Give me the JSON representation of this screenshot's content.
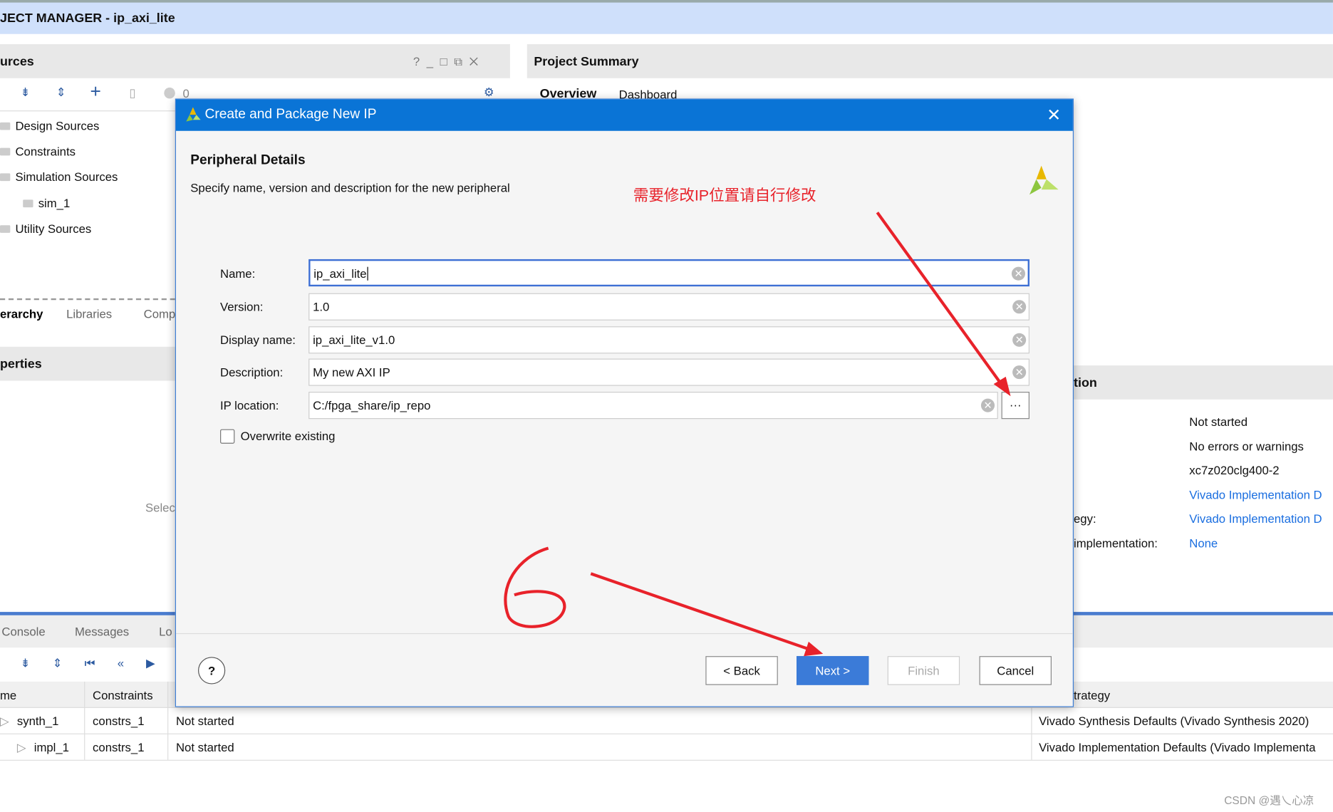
{
  "window": {
    "title": "JECT MANAGER - ip_axi_lite"
  },
  "sources": {
    "title": "urces",
    "count": "0",
    "items": [
      "Design Sources",
      "Constraints",
      "Simulation Sources",
      "sim_1",
      "Utility Sources"
    ],
    "tabs": [
      "erarchy",
      "Libraries",
      "Comp"
    ]
  },
  "properties": {
    "title": "perties",
    "hint": "Selec"
  },
  "summary": {
    "title": "Project Summary",
    "tabs": [
      "Overview",
      "Dashboard"
    ],
    "section": "tion",
    "rows": [
      {
        "label": "",
        "value": "Not started",
        "link": false
      },
      {
        "label": "",
        "value": "No errors or warnings",
        "link": false
      },
      {
        "label": "",
        "value": "xc7z020clg400-2",
        "link": false
      },
      {
        "label": "",
        "value": "Vivado Implementation D",
        "link": true
      },
      {
        "label": "egy:",
        "value": "Vivado Implementation D",
        "link": true
      },
      {
        "label": "implementation:",
        "value": "None",
        "link": true
      }
    ]
  },
  "console": {
    "tabs": [
      "Console",
      "Messages",
      "Lo"
    ]
  },
  "runs": {
    "headers": [
      "me",
      "Constraints",
      "trategy"
    ],
    "rows": [
      {
        "name": "synth_1",
        "constraints": "constrs_1",
        "status": "Not started",
        "strategy": "Vivado Synthesis Defaults (Vivado Synthesis 2020)"
      },
      {
        "name": "impl_1",
        "constraints": "constrs_1",
        "status": "Not started",
        "strategy": "Vivado Implementation Defaults (Vivado Implementa"
      }
    ]
  },
  "dialog": {
    "title": "Create and Package New IP",
    "heading": "Peripheral Details",
    "subheading": "Specify name, version and description for the new peripheral",
    "fields": [
      {
        "label": "Name:",
        "value": "ip_axi_lite"
      },
      {
        "label": "Version:",
        "value": "1.0"
      },
      {
        "label": "Display name:",
        "value": "ip_axi_lite_v1.0"
      },
      {
        "label": "Description:",
        "value": "My new AXI IP"
      },
      {
        "label": "IP location:",
        "value": "C:/fpga_share/ip_repo"
      }
    ],
    "browse": "···",
    "overwrite": "Overwrite existing",
    "overwrite_checked": false,
    "help": "?",
    "back": "< Back",
    "next": "Next >",
    "finish": "Finish",
    "cancel": "Cancel"
  },
  "annotation": {
    "text": "需要修改IP位置请自行修改",
    "number": "6",
    "color": "#e8222a"
  },
  "watermark": "CSDN @遇乀心凉"
}
